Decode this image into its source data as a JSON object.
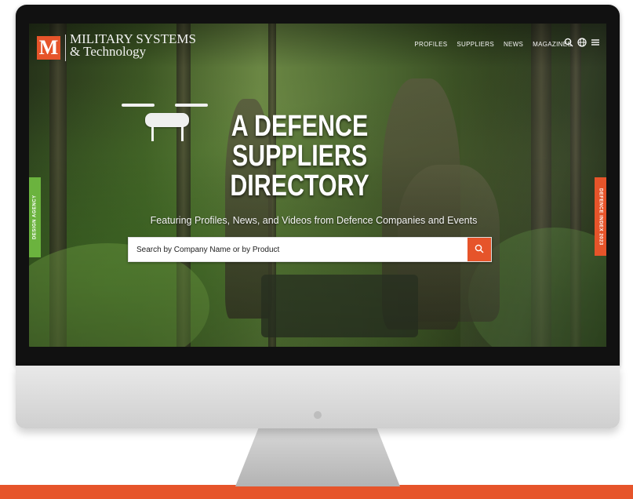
{
  "brand": {
    "logo_letter": "M",
    "name_line1": "MILITARY SYSTEMS",
    "name_line2": "& Technology",
    "accent_color": "#e6542a"
  },
  "nav": {
    "items": [
      "PROFILES",
      "SUPPLIERS",
      "NEWS",
      "MAGAZINES"
    ],
    "icons": [
      "search-icon",
      "globe-icon",
      "menu-icon"
    ]
  },
  "hero": {
    "title_line1": "A DEFENCE",
    "title_line2": "SUPPLIERS",
    "title_line3": "DIRECTORY",
    "subtitle": "Featuring Profiles, News, and Videos from Defence Companies and Events"
  },
  "search": {
    "placeholder": "Search by Company Name or by Product",
    "button_icon": "search-icon"
  },
  "side_tabs": {
    "left_label": "DESIGN AGENCY",
    "left_color": "#6bb33e",
    "right_label": "DEFENCE INDEX 2023",
    "right_color": "#e6542a"
  }
}
